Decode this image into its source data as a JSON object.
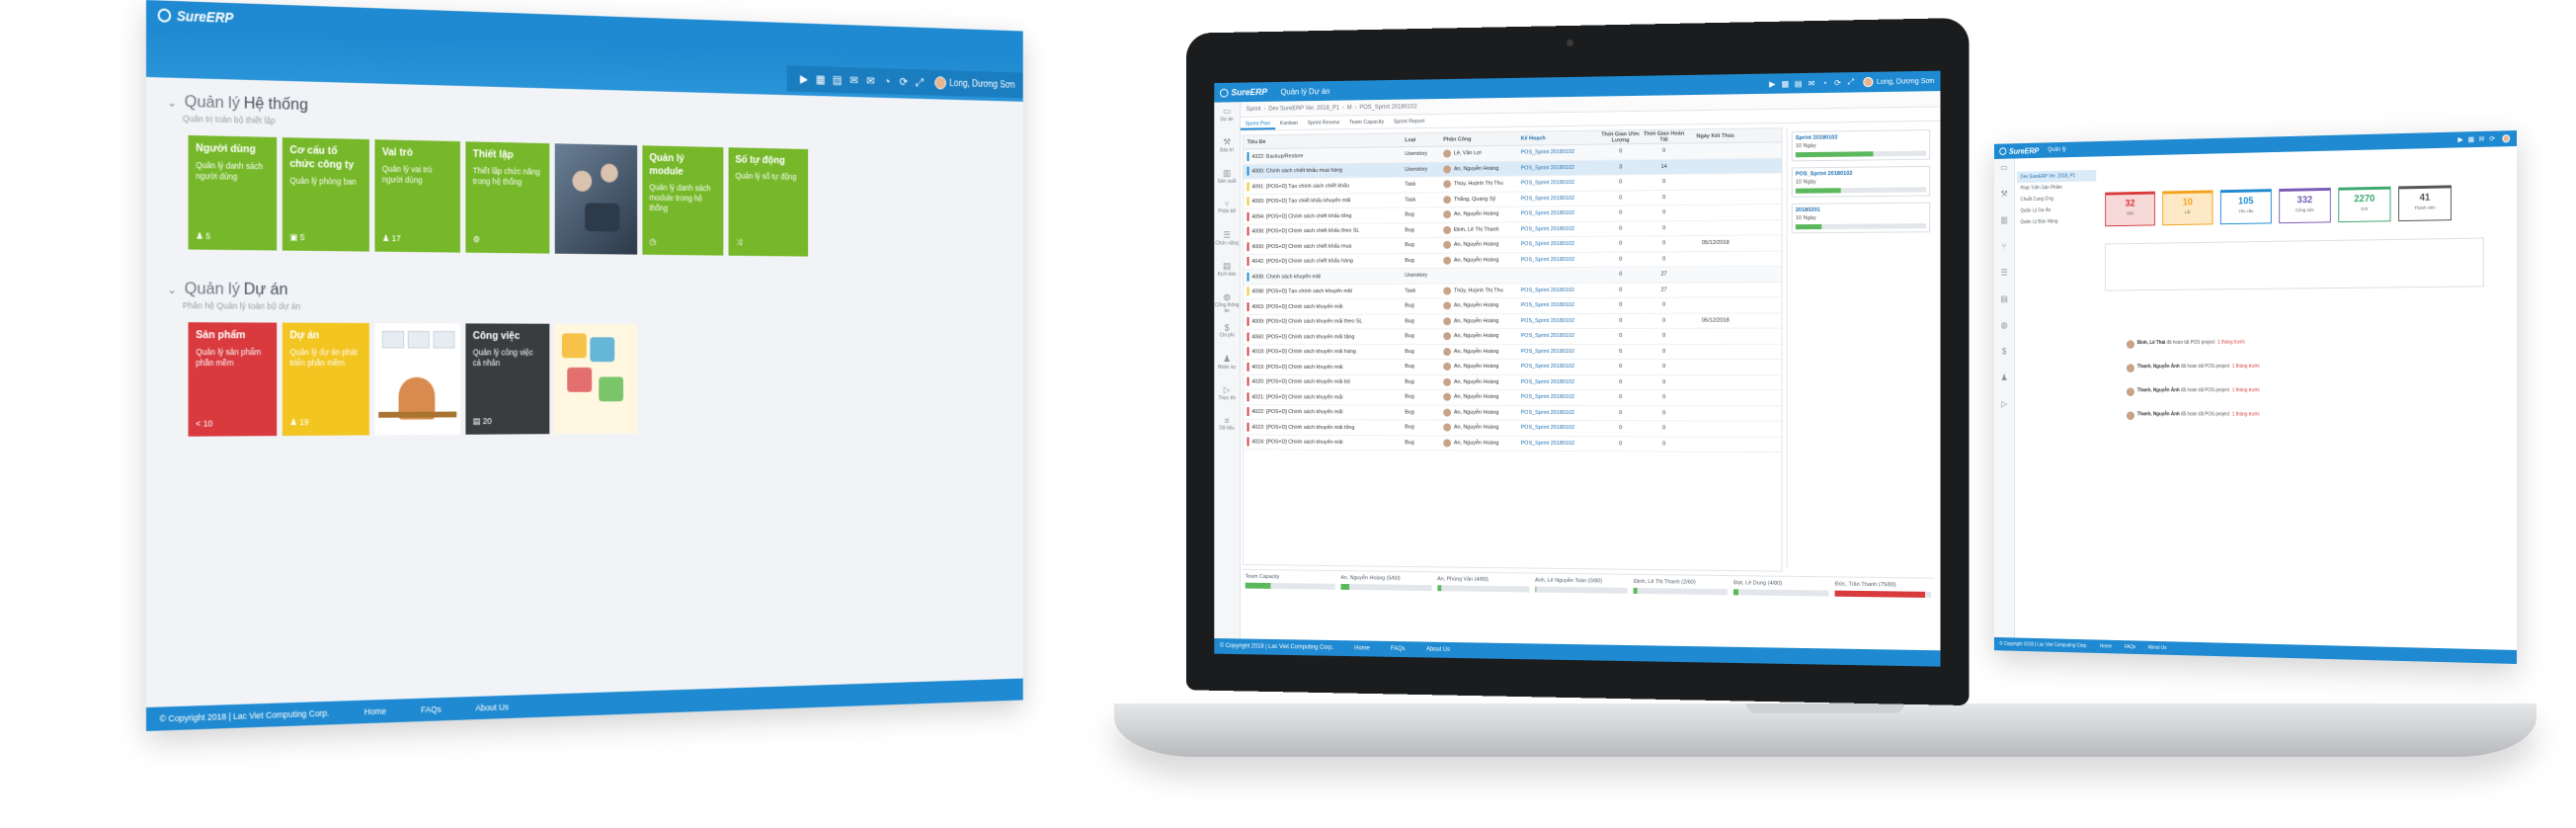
{
  "brand": {
    "logo_text": "SureERP"
  },
  "left_screen": {
    "user_name": "Long, Dương Sơn",
    "toolbar_icons": [
      "play-icon",
      "grid-icon",
      "document-icon",
      "mail-icon",
      "mail-icon",
      "chart-icon",
      "refresh-icon",
      "expand-icon",
      "user-icon"
    ],
    "sections": [
      {
        "title_prefix": "Quản lý",
        "title_main": "Hệ thống",
        "subtitle": "Quản trị toàn bộ thiết lập",
        "tiles": [
          {
            "title": "Người dùng",
            "desc": "Quản lý danh sách người dùng",
            "count": "5",
            "color": "green"
          },
          {
            "title": "Cơ cấu tổ chức công ty",
            "desc": "Quản lý phòng ban",
            "count": "5",
            "color": "green"
          },
          {
            "title": "Vai trò",
            "desc": "Quản lý vai trò người dùng",
            "count": "17",
            "color": "green"
          },
          {
            "title": "Thiết lập",
            "desc": "Thiết lập chức năng trong hệ thống",
            "count": "",
            "color": "green"
          },
          {
            "title": "",
            "desc": "",
            "count": "",
            "color": "photo"
          },
          {
            "title": "Quản lý module",
            "desc": "Quản lý danh sách module trong hệ thống",
            "count": "",
            "color": "green"
          },
          {
            "title": "Số tự động",
            "desc": "Quản lý số tự động",
            "count": "",
            "color": "green"
          }
        ]
      },
      {
        "title_prefix": "Quản lý",
        "title_main": "Dự án",
        "subtitle": "Phân hệ Quản lý toàn bộ dự án",
        "tiles": [
          {
            "title": "Sản phẩm",
            "desc": "Quản lý sản phẩm phần mềm",
            "count": "10",
            "color": "red"
          },
          {
            "title": "Dự án",
            "desc": "Quản lý dự án phát triển phần mềm",
            "count": "19",
            "color": "yellow"
          },
          {
            "title": "",
            "desc": "",
            "count": "",
            "color": "photo"
          },
          {
            "title": "Công việc",
            "desc": "Quản lý công việc cá nhân",
            "count": "20",
            "color": "dark"
          },
          {
            "title": "",
            "desc": "",
            "count": "",
            "color": "photo"
          }
        ]
      }
    ],
    "footer": {
      "copyright": "© Copyright 2018 | Lac Viet Computing Corp.",
      "links": [
        "Home",
        "FAQs",
        "About Us"
      ]
    }
  },
  "mid_screen": {
    "page_name": "Quản lý Dự án",
    "user_name": "Long, Dương Sơn",
    "breadcrumb": [
      "Sprint",
      "Dev SureERP Ver. 2018_P1",
      "M",
      "POS_Sprint 20180102"
    ],
    "tabs": [
      "Sprint Plan",
      "Kanban",
      "Sprint Review",
      "Team Capacity",
      "Sprint Report"
    ],
    "rail": [
      "Dự án",
      "Bảo trì",
      "Sản xuất",
      "Phân bổ",
      "Chức năng",
      "Kịch bản",
      "Cổng thông tin",
      "Chi phí",
      "Nhân sự",
      "Thực thi",
      "Dữ liệu"
    ],
    "columns": [
      "Tiêu Đề",
      "Loại",
      "Phân Công",
      "Kế Hoạch",
      "Thời Gian Ước Lượng",
      "Thời Gian Hoàn Tất",
      "Ngày Kết Thúc"
    ],
    "rows": [
      {
        "title": "4322: Backup/Restore",
        "type": "Userstory",
        "person": "Lê, Văn Lợi",
        "sprint": "POS_Sprint 20180102",
        "est": "0",
        "rem": "0",
        "date": "",
        "kind": "parent",
        "mark": "#1f8ad1"
      },
      {
        "title": "4000: Chính sách chiết khấu mua hàng",
        "type": "Userstory",
        "person": "An, Nguyễn Hoàng",
        "sprint": "POS_Sprint 20180102",
        "est": "3",
        "rem": "14",
        "date": "",
        "kind": "sel",
        "mark": "#1f8ad1"
      },
      {
        "title": "4091: [POS+D] Tạo chính sách chiết khấu",
        "type": "Task",
        "person": "Thúy, Huỳnh Thị Thu",
        "sprint": "POS_Sprint 20180102",
        "est": "0",
        "rem": "0",
        "date": "",
        "kind": "",
        "mark": "#f2c521"
      },
      {
        "title": "4093: [POS+D] Tạo chiết khấu khuyến mãi",
        "type": "Task",
        "person": "Thắng, Quang Sỹ",
        "sprint": "POS_Sprint 20180102",
        "est": "0",
        "rem": "0",
        "date": "",
        "kind": "",
        "mark": "#f2c521"
      },
      {
        "title": "4094: [POS+D] Chính sách chiết khấu tổng",
        "type": "Bug",
        "person": "An, Nguyễn Hoàng",
        "sprint": "POS_Sprint 20180102",
        "est": "0",
        "rem": "0",
        "date": "",
        "kind": "",
        "mark": "#d83a3e"
      },
      {
        "title": "4008: [POS+D] Chính sách chiết khấu theo SL",
        "type": "Bug",
        "person": "Định, Lê Thị Thanh",
        "sprint": "POS_Sprint 20180102",
        "est": "0",
        "rem": "0",
        "date": "",
        "kind": "",
        "mark": "#d83a3e"
      },
      {
        "title": "4000: [POS+D] Chính sách chiết khấu mua",
        "type": "Bug",
        "person": "An, Nguyễn Hoàng",
        "sprint": "POS_Sprint 20180102",
        "est": "0",
        "rem": "0",
        "date": "05/12/2018",
        "kind": "",
        "mark": "#d83a3e"
      },
      {
        "title": "4042: [POS+D] Chính sách chiết khấu hàng",
        "type": "Bug",
        "person": "An, Nguyễn Hoàng",
        "sprint": "POS_Sprint 20180102",
        "est": "0",
        "rem": "0",
        "date": "",
        "kind": "",
        "mark": "#d83a3e"
      },
      {
        "title": "4008: Chính sách khuyến mãi",
        "type": "Userstory",
        "person": "",
        "sprint": "",
        "est": "0",
        "rem": "27",
        "date": "",
        "kind": "parent",
        "mark": "#1f8ad1"
      },
      {
        "title": "4098: [POS+D] Tạo chính sách khuyến mãi",
        "type": "Task",
        "person": "Thủy, Huỳnh Thị Thu",
        "sprint": "POS_Sprint 20180102",
        "est": "0",
        "rem": "27",
        "date": "",
        "kind": "",
        "mark": "#f2c521"
      },
      {
        "title": "4063: [POS+D] Chính sách khuyến mãi",
        "type": "Bug",
        "person": "An, Nguyễn Hoàng",
        "sprint": "POS_Sprint 20180102",
        "est": "0",
        "rem": "0",
        "date": "",
        "kind": "",
        "mark": "#d83a3e"
      },
      {
        "title": "4009: [POS+D] Chính sách khuyến mãi theo SL",
        "type": "Bug",
        "person": "An, Nguyễn Hoàng",
        "sprint": "POS_Sprint 20180102",
        "est": "0",
        "rem": "0",
        "date": "05/12/2018",
        "kind": "",
        "mark": "#d83a3e"
      },
      {
        "title": "4060: [POS+D] Chính sách khuyến mãi tặng",
        "type": "Bug",
        "person": "An, Nguyễn Hoàng",
        "sprint": "POS_Sprint 20180102",
        "est": "0",
        "rem": "0",
        "date": "",
        "kind": "",
        "mark": "#d83a3e"
      },
      {
        "title": "4018: [POS+D] Chính sách khuyến mãi hàng",
        "type": "Bug",
        "person": "An, Nguyễn Hoàng",
        "sprint": "POS_Sprint 20180102",
        "est": "0",
        "rem": "0",
        "date": "",
        "kind": "",
        "mark": "#d83a3e"
      },
      {
        "title": "4019: [POS+D] Chính sách khuyến mãi",
        "type": "Bug",
        "person": "An, Nguyễn Hoàng",
        "sprint": "POS_Sprint 20180102",
        "est": "0",
        "rem": "0",
        "date": "",
        "kind": "",
        "mark": "#d83a3e"
      },
      {
        "title": "4020: [POS+D] Chính sách khuyến mãi bộ",
        "type": "Bug",
        "person": "An, Nguyễn Hoàng",
        "sprint": "POS_Sprint 20180102",
        "est": "0",
        "rem": "0",
        "date": "",
        "kind": "",
        "mark": "#d83a3e"
      },
      {
        "title": "4021: [POS+D] Chính sách khuyến mãi",
        "type": "Bug",
        "person": "An, Nguyễn Hoàng",
        "sprint": "POS_Sprint 20180102",
        "est": "0",
        "rem": "0",
        "date": "",
        "kind": "",
        "mark": "#d83a3e"
      },
      {
        "title": "4022: [POS+D] Chính sách khuyến mãi",
        "type": "Bug",
        "person": "An, Nguyễn Hoàng",
        "sprint": "POS_Sprint 20180102",
        "est": "0",
        "rem": "0",
        "date": "",
        "kind": "",
        "mark": "#d83a3e"
      },
      {
        "title": "4023: [POS+D] Chính sách khuyến mãi tổng",
        "type": "Bug",
        "person": "An, Nguyễn Hoàng",
        "sprint": "POS_Sprint 20180102",
        "est": "0",
        "rem": "0",
        "date": "",
        "kind": "",
        "mark": "#d83a3e"
      },
      {
        "title": "4024: [POS+D] Chính sách khuyến mãi",
        "type": "Bug",
        "person": "An, Nguyễn Hoàng",
        "sprint": "POS_Sprint 20180102",
        "est": "0",
        "rem": "0",
        "date": "",
        "kind": "",
        "mark": "#d83a3e"
      }
    ],
    "sprint_cards": [
      {
        "title": "Sprint 20180102",
        "days": "10 Ngày",
        "progress": 0.6
      },
      {
        "title": "POS_Sprint 20180102",
        "days": "10 Ngày",
        "progress": 0.35
      },
      {
        "title": "20180201",
        "days": "10 Ngày",
        "progress": 0.2
      }
    ],
    "capacity": [
      {
        "name": "Team Capacity",
        "progress": 0.28,
        "color": "#5cb85c"
      },
      {
        "name": "An, Nguyễn Hoàng (5/60)",
        "progress": 0.1,
        "color": "#5cb85c"
      },
      {
        "name": "An, Phùng Văn (4/80)",
        "progress": 0.05,
        "color": "#5cb85c"
      },
      {
        "name": "Anh, Lê Nguyễn Toàn (0/80)",
        "progress": 0.02,
        "color": "#5cb85c"
      },
      {
        "name": "Định, Lê Thị Thanh (2/60)",
        "progress": 0.04,
        "color": "#5cb85c"
      },
      {
        "name": "Đạt, Lê Dung (4/80)",
        "progress": 0.05,
        "color": "#5cb85c"
      },
      {
        "name": "Đức, Trần Thanh (75/80)",
        "progress": 0.94,
        "color": "#d83a3e"
      }
    ],
    "footer": {
      "copyright": "© Copyright 2018 | Lac Viet Computing Corp.",
      "links": [
        "Home",
        "FAQs",
        "About Us"
      ]
    }
  },
  "right_screen": {
    "page_name": "Quản lý",
    "list_items": [
      "Dev SureERP Ver. 2018_P1",
      "Phát Triển Sản Phẩm",
      "Chuỗi Cung Ứng",
      "Quản Lý Dự Án",
      "Quản Lý Bán Hàng"
    ],
    "cards": [
      {
        "value": "32",
        "label": "Việc",
        "color": "#d83a3e",
        "bg": "#f7d9da"
      },
      {
        "value": "10",
        "label": "Lỗi",
        "color": "#f2a31b",
        "bg": "#fde9c5"
      },
      {
        "value": "105",
        "label": "Yêu cầu",
        "color": "#1f8ad1",
        "bg": "#ffffff"
      },
      {
        "value": "332",
        "label": "Công việc",
        "color": "#7a5bb5",
        "bg": "#ffffff"
      },
      {
        "value": "2270",
        "label": "Giờ",
        "color": "#3aa76d",
        "bg": "#ffffff"
      },
      {
        "value": "41",
        "label": "Thành viên",
        "color": "#555555",
        "bg": "#ffffff"
      }
    ],
    "messages": [
      {
        "who": "Bình, Lê Thái",
        "text": "đã hoàn tất POS project",
        "tag": "1 tháng trước"
      },
      {
        "who": "Thanh, Nguyễn Ánh",
        "text": "đã hoàn tất POS project",
        "tag": "1 tháng trước"
      },
      {
        "who": "Thanh, Nguyễn Ánh",
        "text": "đã hoàn tất POS project",
        "tag": "1 tháng trước"
      },
      {
        "who": "Thanh, Nguyễn Ánh",
        "text": "đã hoàn tất POS project",
        "tag": "1 tháng trước"
      }
    ],
    "footer": {
      "copyright": "© Copyright 2018 | Lac Viet Computing Corp.",
      "links": [
        "Home",
        "FAQs",
        "About Us"
      ]
    }
  }
}
